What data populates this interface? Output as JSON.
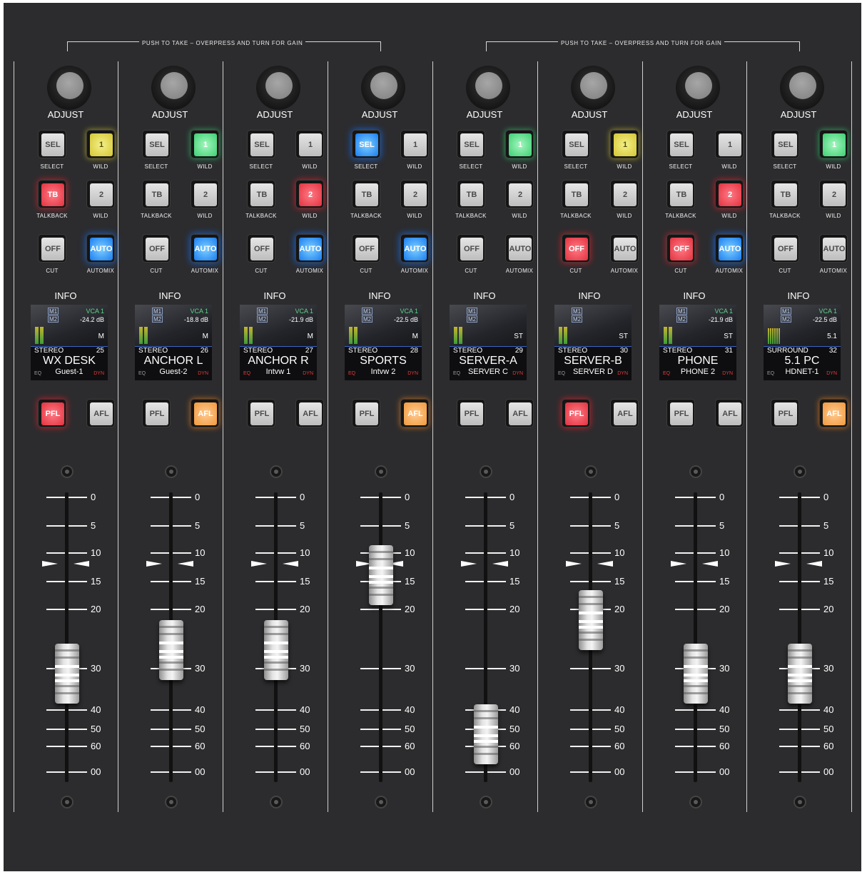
{
  "bracket_label": "PUSH TO TAKE  –  OVERPRESS AND TURN FOR GAIN",
  "labels": {
    "adjust": "ADJUST",
    "info": "INFO",
    "select": "SELECT",
    "wild": "WILD",
    "talkback": "TALKBACK",
    "cut": "CUT",
    "automix": "AUTOMIX",
    "sel": "SEL",
    "one": "1",
    "two": "2",
    "tb": "TB",
    "off": "OFF",
    "auto": "AUTO",
    "pfl": "PFL",
    "afl": "AFL",
    "m1": "M1",
    "m2": "M2",
    "eq": "EQ",
    "dyn": "DYN"
  },
  "scale_marks": [
    "0",
    "5",
    "10",
    "15",
    "20",
    "30",
    "40",
    "50",
    "60",
    "00"
  ],
  "colors": {
    "panel": "#2c2c2e",
    "yellow": "#d4c634",
    "green": "#3ecf72",
    "red": "#e2323f",
    "blue": "#1a7df0",
    "orange": "#f09a3e",
    "vca_text": "#5fd38a"
  },
  "strips": [
    {
      "sel": "white",
      "wild1": "yellow",
      "tb": "red",
      "wild2": "white",
      "off": "white",
      "auto": "blue",
      "pfl": "red",
      "afl": "white",
      "vca": "VCA 1",
      "level": "-24.2 dB",
      "mode": "M",
      "type": "STEREO",
      "number": "25",
      "name": "WX DESK",
      "sub": "Guest-1",
      "eq_active": false,
      "fader_db": 30
    },
    {
      "sel": "white",
      "wild1": "green",
      "tb": "white",
      "wild2": "white",
      "off": "white",
      "auto": "blue",
      "pfl": "white",
      "afl": "orange",
      "vca": "VCA 1",
      "level": "-18.8 dB",
      "mode": "M",
      "type": "STEREO",
      "number": "26",
      "name": "ANCHOR L",
      "sub": "Guest-2",
      "eq_active": false,
      "fader_db": 26
    },
    {
      "sel": "white",
      "wild1": "white",
      "tb": "white",
      "wild2": "red",
      "off": "white",
      "auto": "blue",
      "pfl": "white",
      "afl": "white",
      "vca": "VCA 1",
      "level": "-21.9 dB",
      "mode": "M",
      "type": "STEREO",
      "number": "27",
      "name": "ANCHOR R",
      "sub": "Intvw 1",
      "eq_active": true,
      "fader_db": 26
    },
    {
      "sel": "blue",
      "wild1": "white",
      "tb": "white",
      "wild2": "white",
      "off": "white",
      "auto": "blue",
      "pfl": "white",
      "afl": "orange",
      "vca": "VCA 1",
      "level": "-22.5 dB",
      "mode": "M",
      "type": "STEREO",
      "number": "28",
      "name": "SPORTS",
      "sub": "Intvw 2",
      "eq_active": true,
      "fader_db": 13
    },
    {
      "sel": "white",
      "wild1": "green",
      "tb": "white",
      "wild2": "white",
      "off": "white",
      "auto": "white",
      "pfl": "white",
      "afl": "white",
      "vca": "",
      "level": "",
      "mode": "ST",
      "type": "STEREO",
      "number": "29",
      "name": "SERVER-A",
      "sub": "SERVER C",
      "eq_active": false,
      "fader_db": 50
    },
    {
      "sel": "white",
      "wild1": "yellow",
      "tb": "white",
      "wild2": "white",
      "off": "red",
      "auto": "white",
      "pfl": "red",
      "afl": "white",
      "vca": "",
      "level": "",
      "mode": "ST",
      "type": "STEREO",
      "number": "30",
      "name": "SERVER-B",
      "sub": "SERVER D",
      "eq_active": false,
      "fader_db": 21
    },
    {
      "sel": "white",
      "wild1": "white",
      "tb": "white",
      "wild2": "red",
      "off": "red",
      "auto": "blue",
      "pfl": "white",
      "afl": "white",
      "vca": "VCA 1",
      "level": "-21.9 dB",
      "mode": "ST",
      "type": "STEREO",
      "number": "31",
      "name": "PHONE",
      "sub": "PHONE 2",
      "eq_active": true,
      "fader_db": 30
    },
    {
      "sel": "white",
      "wild1": "green",
      "tb": "white",
      "wild2": "white",
      "off": "white",
      "auto": "white",
      "pfl": "white",
      "afl": "orange",
      "vca": "VCA 1",
      "level": "-22.5 dB",
      "mode": "5.1",
      "type": "SURROUND",
      "number": "32",
      "name": "5.1 PC",
      "sub": "HDNET-1",
      "eq_active": false,
      "fader_db": 30
    }
  ]
}
